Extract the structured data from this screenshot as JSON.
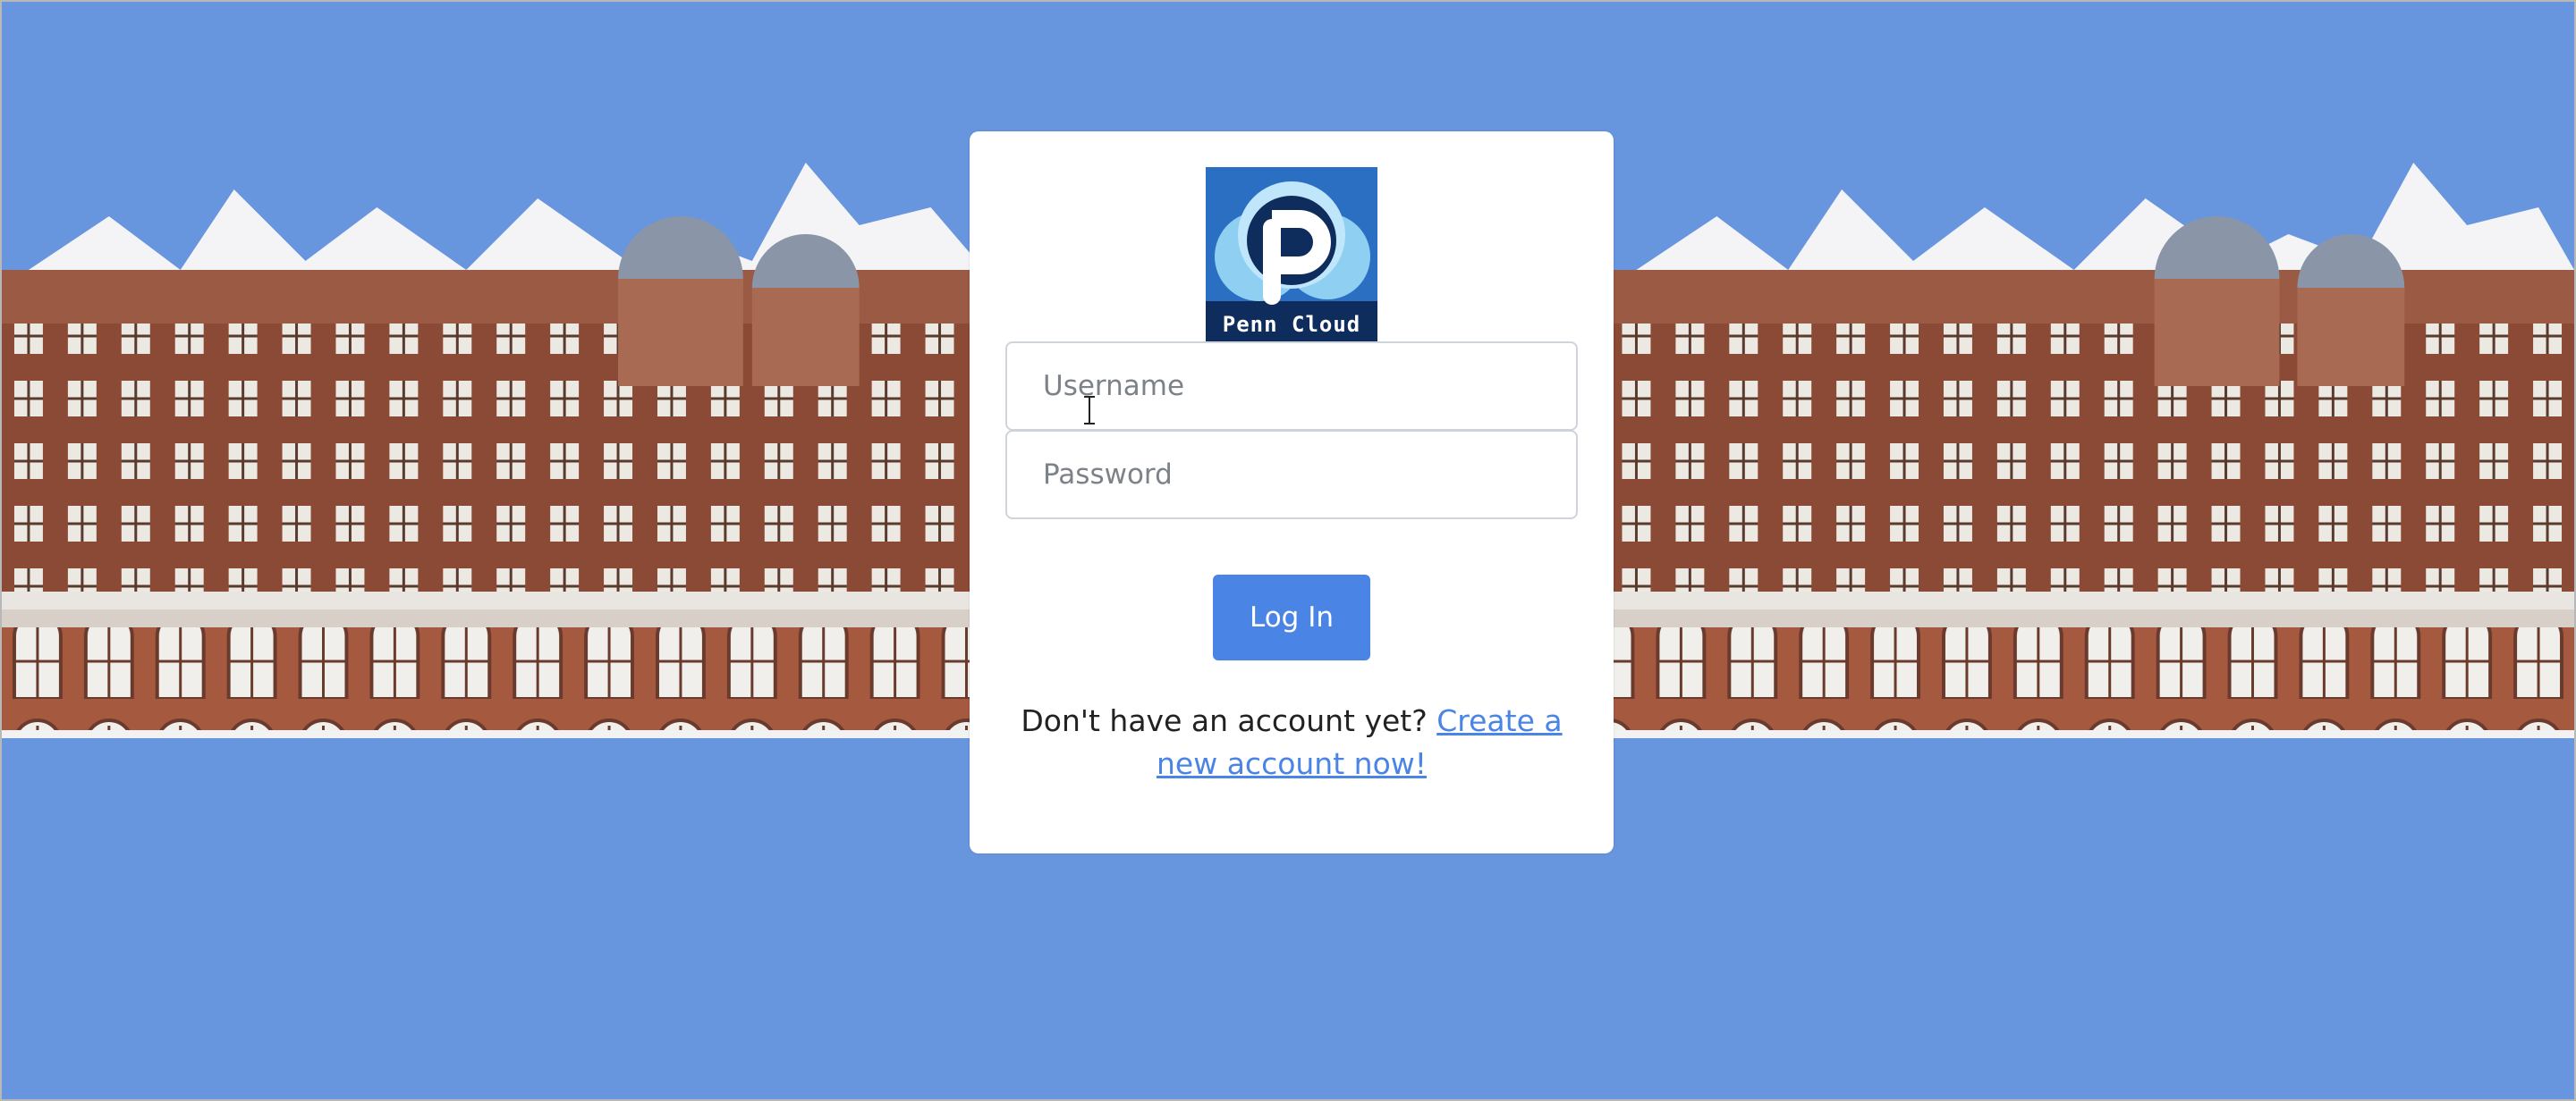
{
  "background": {
    "image": "Snow-covered brick collegiate gothic building quadrangle",
    "sky_color": "#6795de"
  },
  "logo": {
    "icon": "penn-cloud-logo",
    "text": "Penn Cloud"
  },
  "form": {
    "username_placeholder": "Username",
    "password_placeholder": "Password",
    "login_label": "Log In"
  },
  "signup": {
    "prompt": "Don't have an account yet?",
    "link": "Create a new account now!"
  },
  "colors": {
    "accent": "#4a84e4",
    "page_bg": "#6795de",
    "logo_bg": "#0e2c5c"
  }
}
